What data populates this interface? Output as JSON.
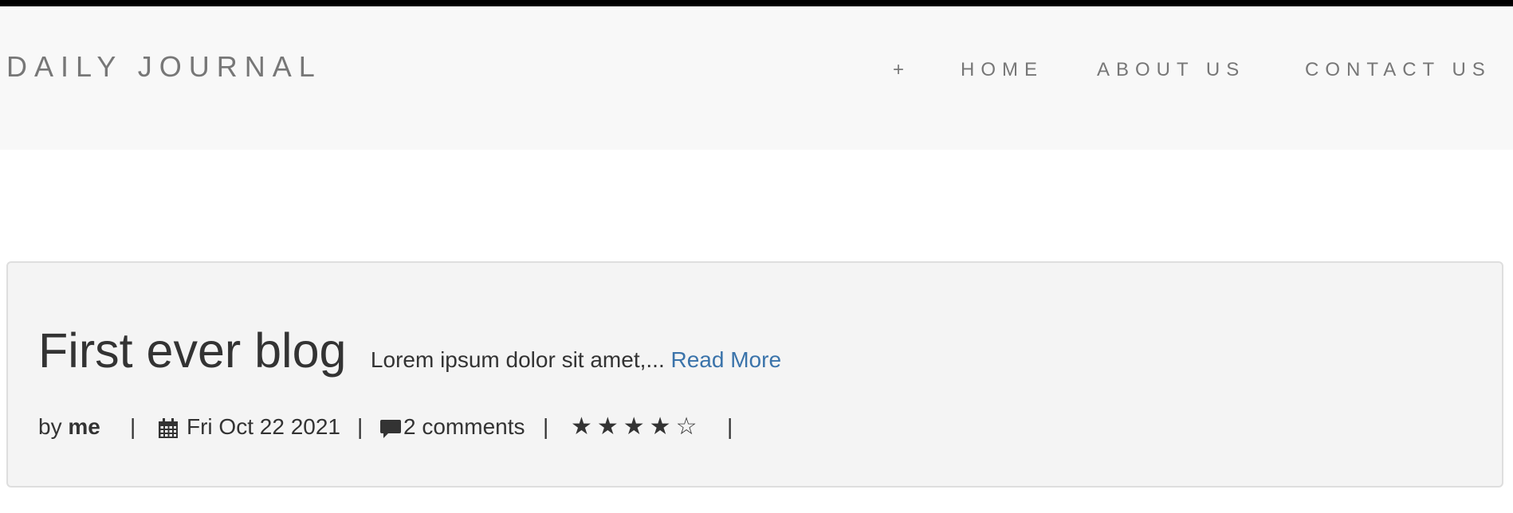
{
  "header": {
    "brand": "DAILY JOURNAL",
    "nav": {
      "compose": "+",
      "home": "HOME",
      "about": "ABOUT US",
      "contact": "CONTACT US"
    }
  },
  "post": {
    "title": "First ever blog",
    "excerpt": "Lorem ipsum dolor sit amet,...",
    "read_more": "Read More",
    "by_prefix": "by",
    "author": "me",
    "separator": "|",
    "date": "Fri Oct 22 2021",
    "comments": "2 comments",
    "stars_display": "★★★★☆",
    "rating": 4,
    "rating_max": 5,
    "icons": {
      "date": "calendar-icon",
      "comments": "comment-icon"
    }
  },
  "colors": {
    "top_bar": "#000000",
    "navbar_bg": "#f8f8f8",
    "nav_text": "#777777",
    "card_bg": "#f4f4f4",
    "card_border": "#dedede",
    "link": "#3a73aa",
    "text": "#333333"
  }
}
